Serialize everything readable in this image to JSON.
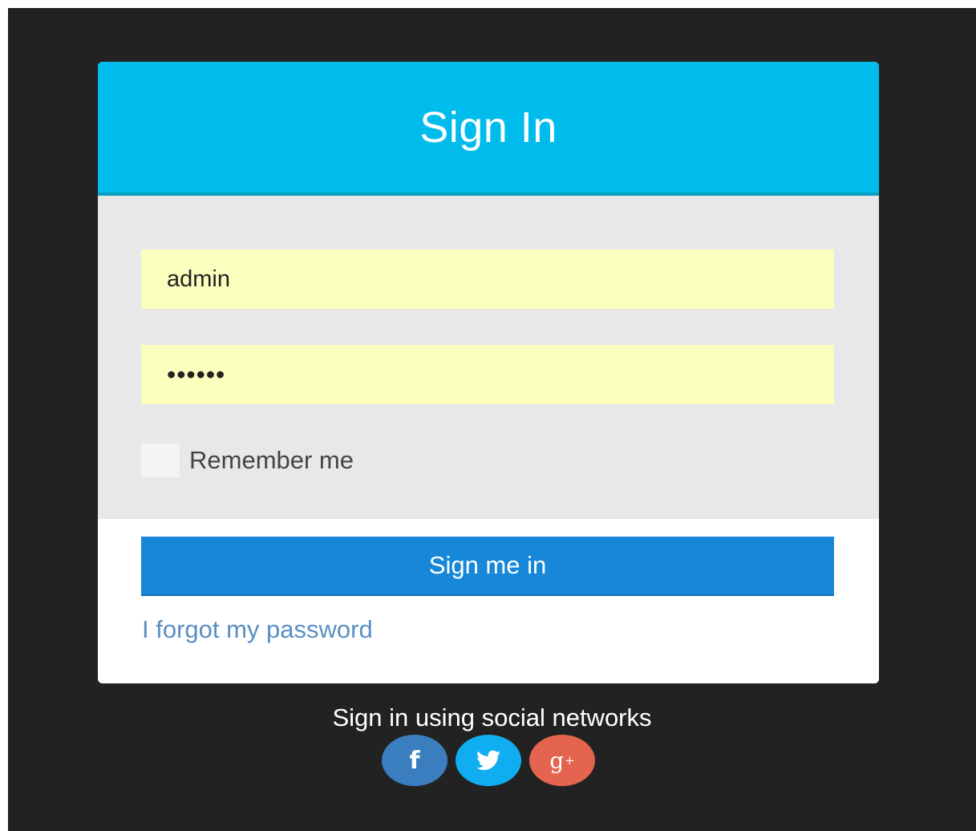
{
  "header": {
    "title": "Sign In"
  },
  "form": {
    "username_value": "admin",
    "password_value": "••••••",
    "remember_label": "Remember me",
    "remember_checked": false,
    "submit_label": "Sign me in",
    "forgot_label": "I forgot my password"
  },
  "social": {
    "heading": "Sign in using social networks",
    "buttons": [
      {
        "icon": "facebook-icon",
        "glyph": "f",
        "color": "#3b7ec0"
      },
      {
        "icon": "twitter-icon",
        "color": "#10aef0"
      },
      {
        "icon": "google-plus-icon",
        "glyph": "g",
        "superscript": "+",
        "color": "#e4644f"
      }
    ]
  },
  "colors": {
    "header_accent": "#00bced",
    "button_primary": "#1787d9",
    "autofill_field": "#faffbd",
    "page_background": "#222222"
  }
}
